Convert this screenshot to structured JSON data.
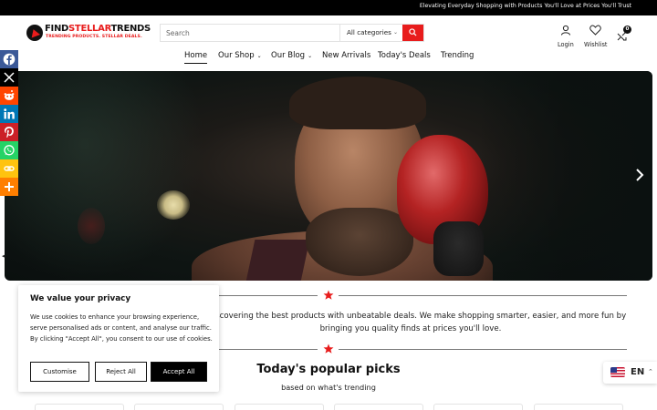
{
  "announcement": "Elevating Everyday Shopping with Products You'll Love at Prices You'll Trust",
  "brand": {
    "name_part1": "FIND",
    "name_part2": "STELLAR",
    "name_part3": "TRENDS",
    "tagline": "TRENDING PRODUCTS. STELLAR DEALS.",
    "accent_color": "#e81c1c"
  },
  "search": {
    "placeholder": "Search",
    "category": "All categories",
    "button_icon": "search-icon"
  },
  "header_icons": {
    "login": {
      "label": "Login",
      "icon": "user-icon"
    },
    "wishlist": {
      "label": "Wishlist",
      "icon": "heart-icon"
    },
    "cart": {
      "count": "0",
      "icon": "compare-icon"
    }
  },
  "nav": {
    "items": [
      {
        "label": "Home",
        "active": true
      },
      {
        "label": "Our Shop",
        "dropdown": true
      },
      {
        "label": "Our Blog",
        "dropdown": true
      },
      {
        "label": "New Arrivals"
      },
      {
        "label": "Today's Deals"
      },
      {
        "label": "Trending"
      }
    ]
  },
  "social": [
    {
      "name": "facebook-icon",
      "color": "#3b5998"
    },
    {
      "name": "x-icon",
      "color": "#000000"
    },
    {
      "name": "reddit-icon",
      "color": "#ff4500"
    },
    {
      "name": "linkedin-icon",
      "color": "#0077b5"
    },
    {
      "name": "pinterest-icon",
      "color": "#cb2027"
    },
    {
      "name": "whatsapp-icon",
      "color": "#25d366"
    },
    {
      "name": "copy-link-icon",
      "color": "#ffc30f"
    },
    {
      "name": "more-icon",
      "color": "#ff7f00"
    }
  ],
  "intro_text": "for discovering the best products with unbeatable deals. We make shopping smarter, easier, and more fun by bringing you quality finds at prices you'll love.",
  "popular": {
    "title": "Today's popular picks",
    "subtitle": "based on what's trending"
  },
  "cookie": {
    "title": "We value your privacy",
    "body": "We use cookies to enhance your browsing experience, serve personalised ads or content, and analyse our traffic. By clicking \"Accept All\", you consent to our use of cookies.",
    "customise": "Customise",
    "reject": "Reject All",
    "accept": "Accept All"
  },
  "language": {
    "code": "EN",
    "flag": "us-flag-icon"
  }
}
